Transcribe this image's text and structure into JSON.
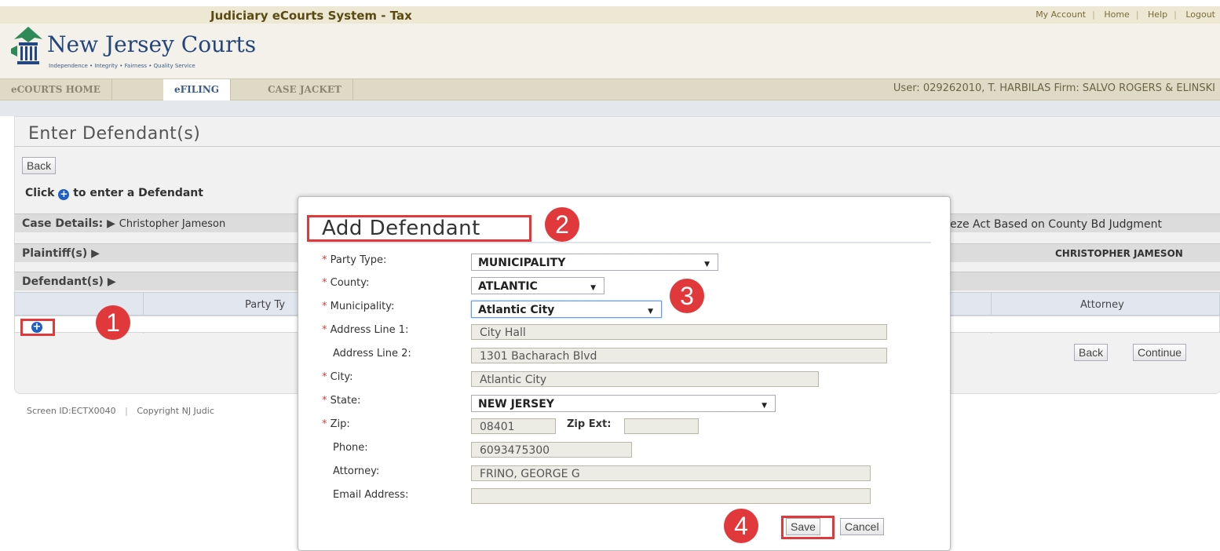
{
  "header": {
    "system_title": "Judiciary eCourts System - Tax",
    "links": [
      "My Account",
      "Home",
      "Help",
      "Logout"
    ],
    "logo_title": "New Jersey Courts",
    "tagline": "Independence • Integrity • Fairness • Quality Service",
    "tabs": [
      "eCOURTS HOME",
      "eFILING",
      "CASE JACKET"
    ],
    "user_info": "User: 029262010, T. HARBILAS  Firm: SALVO ROGERS & ELINSKI"
  },
  "page": {
    "title": "Enter Defendant(s)",
    "back_label": "Back",
    "click_hint_prefix": "Click",
    "click_hint_suffix": "to enter a Defendant",
    "case_details_label": "Case Details:",
    "case_details_text": "Christopher Jameson",
    "case_details_right": "eze Act  Based on County Bd Judgment",
    "plaintiffs_label": "Plaintiff(s)",
    "plaintiffs_right": "CHRISTOPHER JAMESON",
    "defendants_label": "Defendant(s)",
    "grid_col_party": "Party Ty",
    "grid_col_attorney": "Attorney",
    "back2_label": "Back",
    "continue_label": "Continue",
    "footer_screen": "Screen ID:ECTX0040",
    "footer_copyright": "Copyright NJ Judic"
  },
  "modal": {
    "title": "Add Defendant",
    "party_type_label": "Party Type:",
    "party_type_value": "MUNICIPALITY",
    "county_label": "County:",
    "county_value": "ATLANTIC",
    "municipality_label": "Municipality:",
    "municipality_value": "Atlantic City",
    "address1_label": "Address Line 1:",
    "address1_value": "City Hall",
    "address2_label": "Address Line 2:",
    "address2_value": "1301 Bacharach Blvd",
    "city_label": "City:",
    "city_value": "Atlantic City",
    "state_label": "State:",
    "state_value": "NEW JERSEY",
    "zip_label": "Zip:",
    "zip_value": "08401",
    "zipext_label": "Zip Ext:",
    "zipext_value": "",
    "phone_label": "Phone:",
    "phone_value": "6093475300",
    "attorney_label": "Attorney:",
    "attorney_value": "FRINO, GEORGE G",
    "email_label": "Email Address:",
    "email_value": "",
    "save_label": "Save",
    "cancel_label": "Cancel",
    "required_marker": "*"
  },
  "badges": [
    "1",
    "2",
    "3",
    "4"
  ],
  "colors": {
    "annotation_red": "#e0383b",
    "brand_blue": "#23467e",
    "plus_blue": "#1f5fc4"
  },
  "icons": {
    "plus": "plus-circle-icon",
    "expand": "triangle-right-icon",
    "dropdown": "dropdown-arrow-icon"
  }
}
